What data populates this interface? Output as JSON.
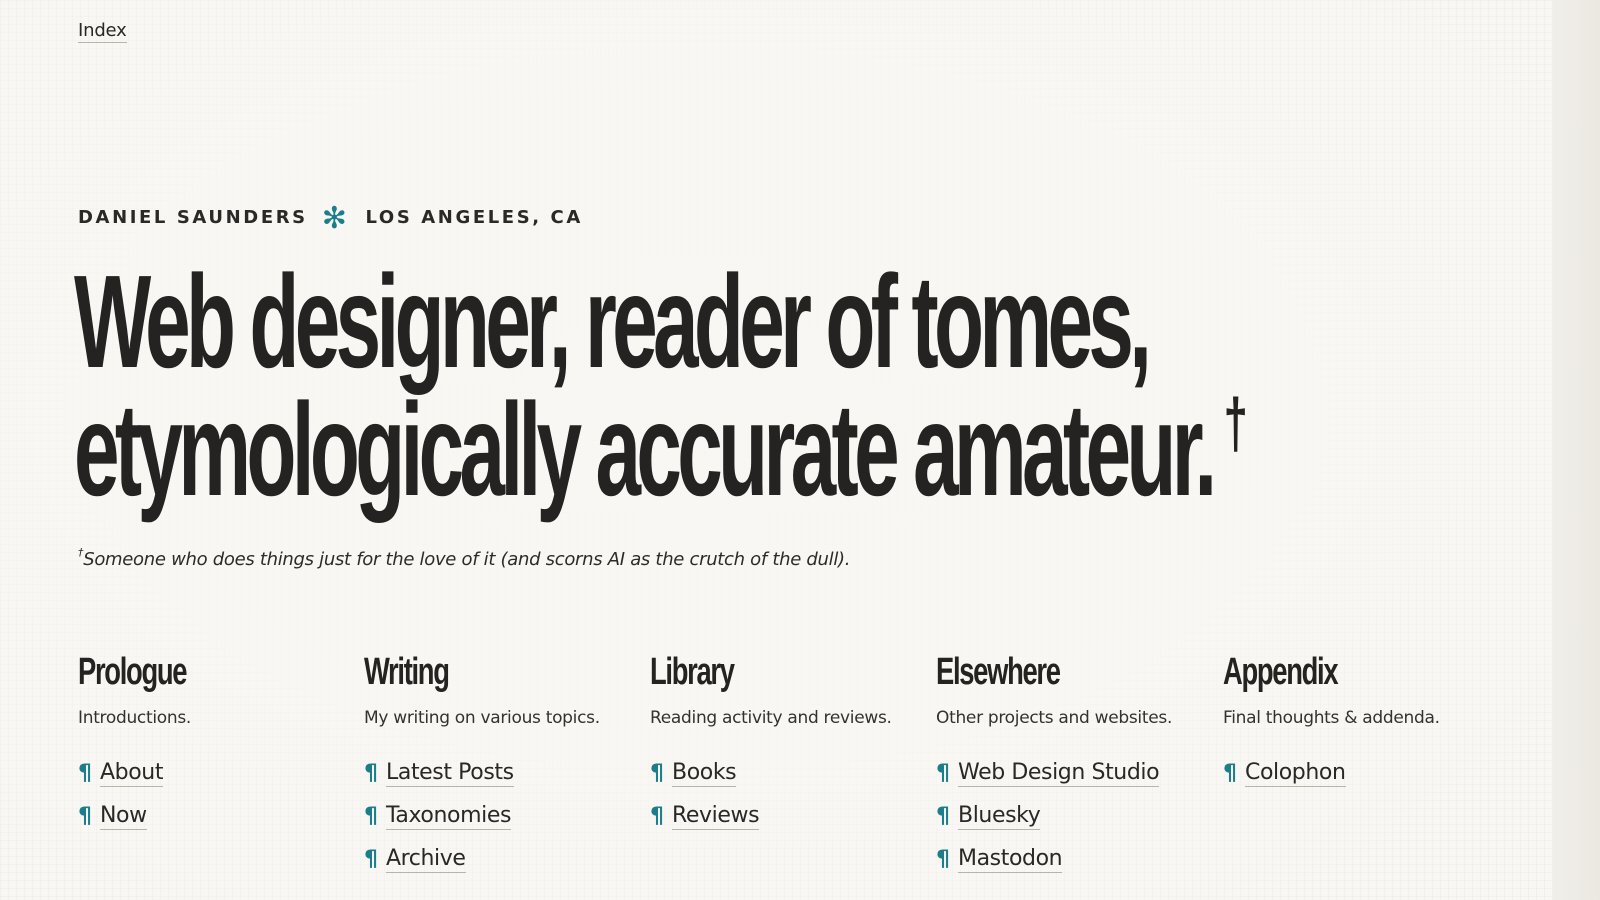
{
  "nav": {
    "index_label": "Index"
  },
  "intro": {
    "name": "DANIEL SAUNDERS",
    "separator_icon": "asterisk-icon",
    "location": "LOS ANGELES, CA",
    "headline_line1": "Web designer, reader of tomes,",
    "headline_line2": "etymologically accurate amateur.",
    "headline_mark": "†",
    "footnote_mark": "†",
    "footnote_text": "Someone who does things just for the love of it (and scorns AI as the crutch of the dull)."
  },
  "sections": [
    {
      "title": "Prologue",
      "description": "Introductions.",
      "links": [
        "About",
        "Now"
      ]
    },
    {
      "title": "Writing",
      "description": "My writing on various topics.",
      "links": [
        "Latest Posts",
        "Taxonomies",
        "Archive"
      ]
    },
    {
      "title": "Library",
      "description": "Reading activity and reviews.",
      "links": [
        "Books",
        "Reviews"
      ]
    },
    {
      "title": "Elsewhere",
      "description": "Other projects and websites.",
      "links": [
        "Web Design Studio",
        "Bluesky",
        "Mastodon"
      ]
    },
    {
      "title": "Appendix",
      "description": "Final thoughts & addenda.",
      "links": [
        "Colophon"
      ]
    }
  ],
  "link_marker": "¶",
  "colors": {
    "accent": "#1c7e8a",
    "text": "#252321",
    "background": "#f8f7f3"
  }
}
